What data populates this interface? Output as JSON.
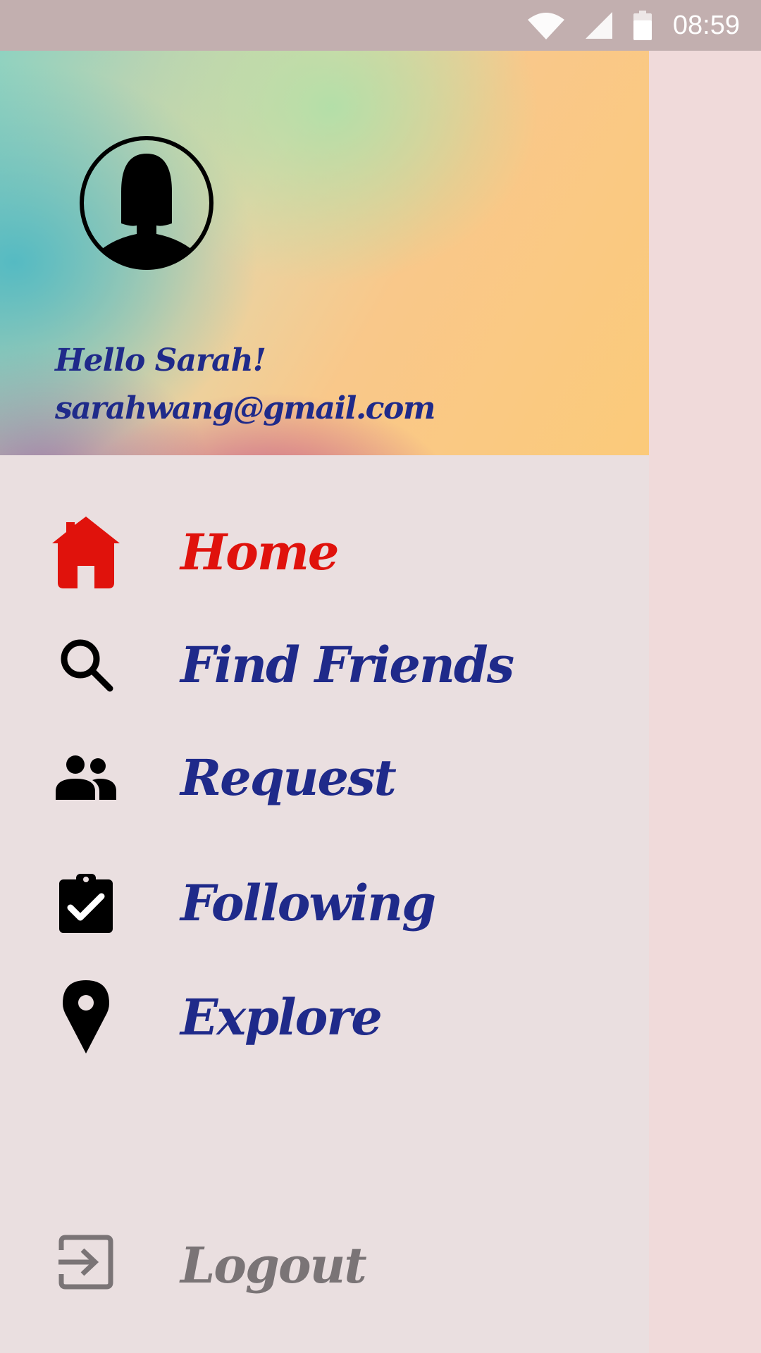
{
  "status_bar": {
    "time": "08:59",
    "icons": [
      "wifi-icon",
      "signal-icon",
      "battery-icon"
    ]
  },
  "drawer": {
    "header": {
      "greeting": "Hello Sarah!",
      "email": "sarahwang@gmail.com",
      "avatar_icon": "female-avatar-icon"
    },
    "items": [
      {
        "label": "Home",
        "icon": "home-icon",
        "active": true
      },
      {
        "label": "Find Friends",
        "icon": "search-icon",
        "active": false
      },
      {
        "label": "Request",
        "icon": "people-icon",
        "active": false
      },
      {
        "label": "Following",
        "icon": "clipboard-check-icon",
        "active": false
      },
      {
        "label": "Explore",
        "icon": "location-pin-icon",
        "active": false
      }
    ],
    "logout": {
      "label": "Logout",
      "icon": "logout-icon"
    }
  },
  "colors": {
    "status_bar": "#c2afaf",
    "drawer_bg": "#eadfe0",
    "active": "#e0120c",
    "text": "#1f2a8a",
    "muted": "#7a7476"
  }
}
